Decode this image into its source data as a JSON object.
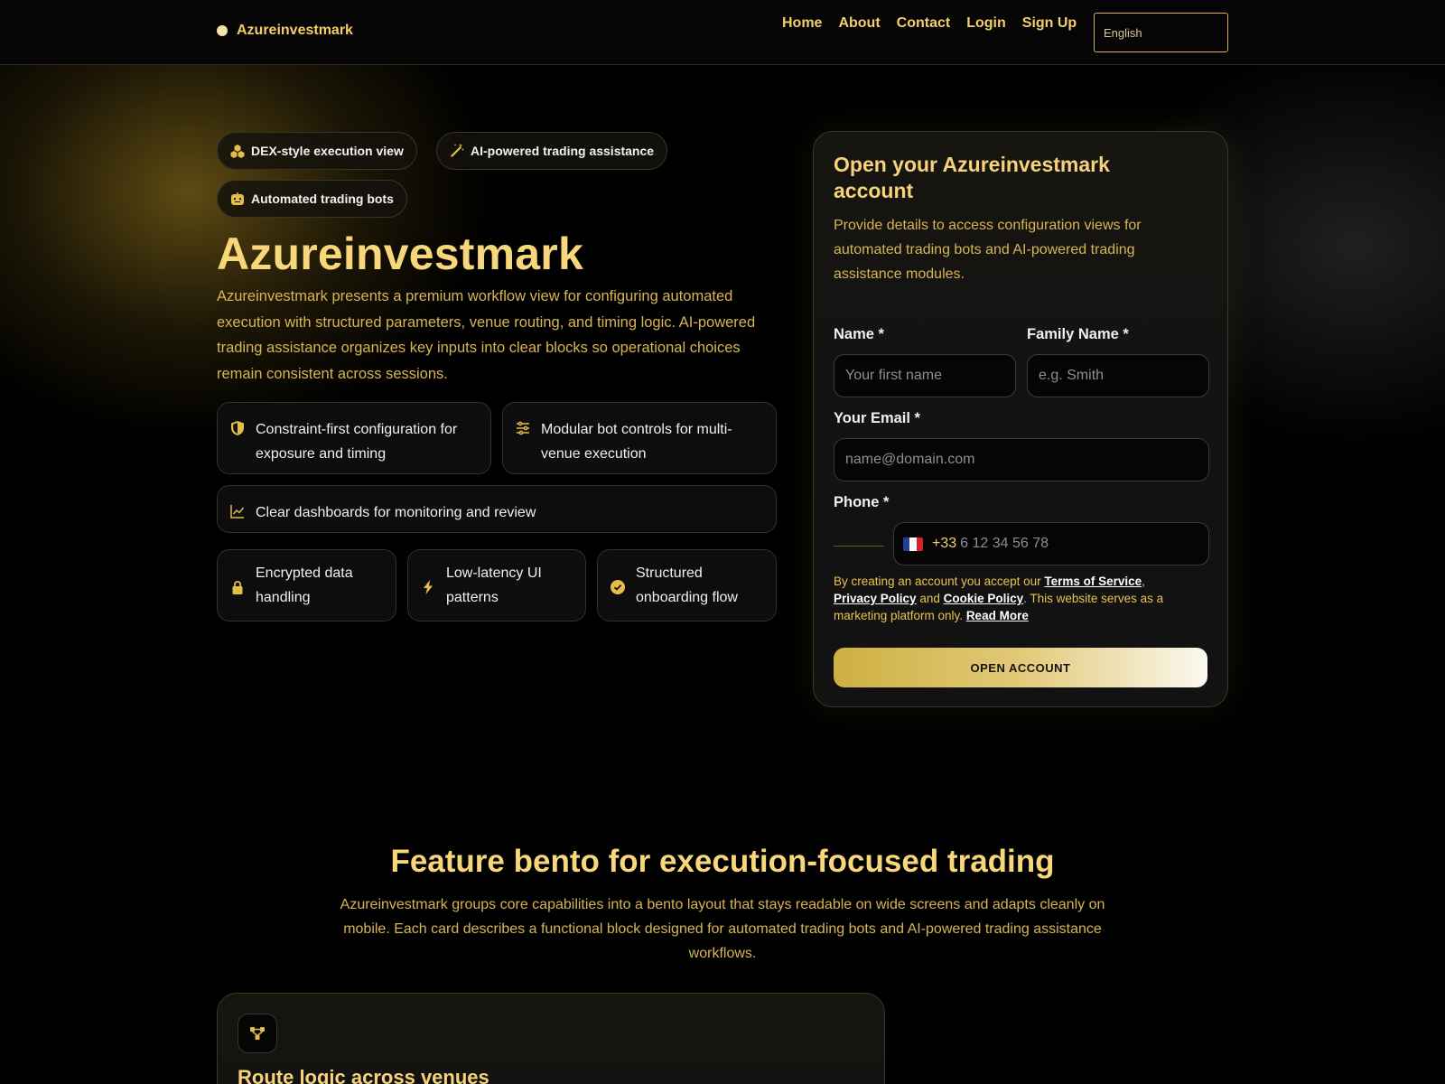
{
  "header": {
    "brand": "Azureinvestmark",
    "nav": [
      "Home",
      "About",
      "Contact",
      "Login",
      "Sign Up"
    ],
    "language": "English"
  },
  "hero": {
    "chips": [
      {
        "label": "DEX-style execution view",
        "icon": "cubes-icon"
      },
      {
        "label": "AI-powered trading assistance",
        "icon": "magic-wand-icon"
      },
      {
        "label": "Automated trading bots",
        "icon": "robot-icon"
      }
    ],
    "title": "Azureinvestmark",
    "description": "Azureinvestmark presents a premium workflow view for configuring automated execution with structured parameters, venue routing, and timing logic. AI-powered trading assistance organizes key inputs into clear blocks so operational choices remain consistent across sessions.",
    "features": [
      {
        "text": "Constraint-first configuration for exposure and timing",
        "icon": "shield-icon"
      },
      {
        "text": "Modular bot controls for multi-venue execution",
        "icon": "sliders-icon"
      },
      {
        "text": "Clear dashboards for monitoring and review",
        "icon": "line-chart-icon"
      }
    ],
    "badges": [
      {
        "text": "Encrypted data handling",
        "icon": "lock-icon"
      },
      {
        "text": "Low-latency UI patterns",
        "icon": "lightning-icon"
      },
      {
        "text": "Structured onboarding flow",
        "icon": "check-circle-icon"
      }
    ]
  },
  "form": {
    "title": "Open your Azureinvestmark account",
    "subtitle": "Provide details to access configuration views for automated trading bots and AI-powered trading assistance modules.",
    "first_name_label": "Name *",
    "first_name_placeholder": "Your first name",
    "family_name_label": "Family Name *",
    "family_name_placeholder": "e.g. Smith",
    "email_label": "Your Email *",
    "email_placeholder": "name@domain.com",
    "phone_label": "Phone *",
    "dial_code": "+33",
    "phone_placeholder": "6 12 34 56 78",
    "flag_colors": [
      "#1f3f9a",
      "#ffffff",
      "#d8232a"
    ],
    "legal": {
      "prefix": "By creating an account you accept our ",
      "terms": "Terms of Service",
      "comma": ",",
      "privacy": "Privacy Policy",
      "and": " and ",
      "cookie": "Cookie Policy",
      "suffix": ". This website serves as a marketing platform only. ",
      "read_more": "Read More"
    },
    "submit": "OPEN ACCOUNT"
  },
  "bento": {
    "title": "Feature bento for execution-focused trading",
    "description": "Azureinvestmark groups core capabilities into a bento layout that stays readable on wide screens and adapts cleanly on mobile. Each card describes a functional block designed for automated trading bots and AI-powered trading assistance workflows.",
    "cards": [
      {
        "title": "Route logic across venues",
        "icon": "route-nodes-icon"
      }
    ]
  },
  "colors": {
    "accent": "#f3cf6b",
    "gold_text": "#d8b553",
    "background": "#000000"
  }
}
